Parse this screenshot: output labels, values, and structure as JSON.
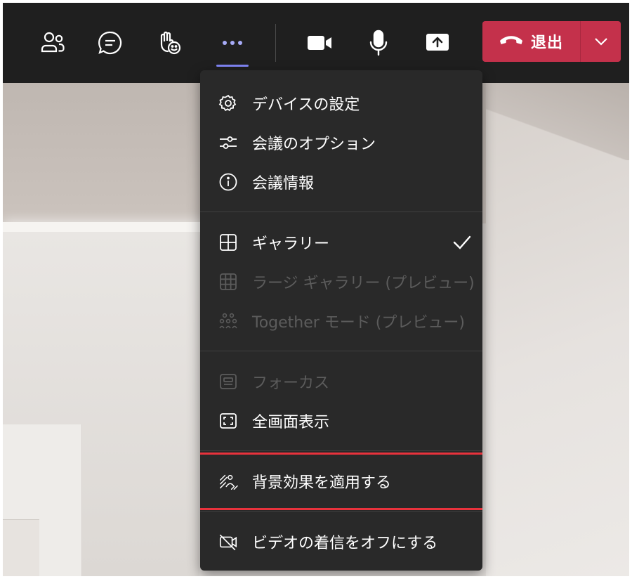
{
  "toolbar": {
    "leave_label": "退出",
    "icons": {
      "people": "people-icon",
      "chat": "chat-icon",
      "reactions": "raise-hand-icon",
      "more": "more-icon",
      "camera": "camera-icon",
      "mic": "microphone-icon",
      "share": "share-screen-icon",
      "leave": "phone-hangup-icon",
      "leave_options": "chevron-down-icon"
    },
    "accent_color": "#7f85f5",
    "leave_color": "#c4314b"
  },
  "menu": {
    "items": [
      {
        "label": "デバイスの設定",
        "icon": "gear-icon",
        "enabled": true
      },
      {
        "label": "会議のオプション",
        "icon": "sliders-icon",
        "enabled": true
      },
      {
        "label": "会議情報",
        "icon": "info-icon",
        "enabled": true
      },
      {
        "label": "ギャラリー",
        "icon": "grid-icon",
        "enabled": true,
        "checked": true
      },
      {
        "label": "ラージ ギャラリー (プレビュー)",
        "icon": "large-grid-icon",
        "enabled": false
      },
      {
        "label": "Together モード (プレビュー)",
        "icon": "together-mode-icon",
        "enabled": false
      },
      {
        "label": "フォーカス",
        "icon": "focus-icon",
        "enabled": false
      },
      {
        "label": "全画面表示",
        "icon": "fullscreen-icon",
        "enabled": true
      },
      {
        "label": "背景効果を適用する",
        "icon": "background-effects-icon",
        "enabled": true,
        "highlighted": true
      },
      {
        "label": "ビデオの着信をオフにする",
        "icon": "video-off-icon",
        "enabled": true
      }
    ],
    "highlight_color": "#e8323c"
  }
}
